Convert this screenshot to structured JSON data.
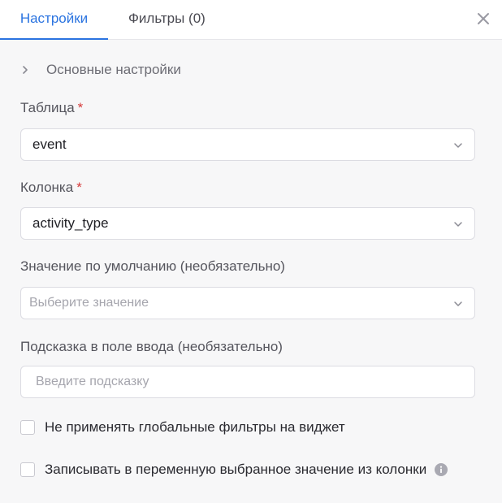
{
  "tabs": {
    "settings": "Настройки",
    "filters": "Фильтры (0)"
  },
  "section": {
    "main_settings": "Основные настройки"
  },
  "fields": {
    "table": {
      "label": "Таблица",
      "required_mark": "*",
      "value": "event"
    },
    "column": {
      "label": "Колонка",
      "required_mark": "*",
      "value": "activity_type"
    },
    "default_value": {
      "label": "Значение по умолчанию (необязательно)",
      "placeholder": "Выберите значение"
    },
    "hint": {
      "label": "Подсказка в поле ввода (необязательно)",
      "placeholder": "Введите подсказку"
    }
  },
  "checkboxes": {
    "ignore_global_filters": {
      "label": "Не применять глобальные фильтры на виджет",
      "checked": false
    },
    "write_to_variable": {
      "label": "Записывать в переменную выбранное значение из колонки",
      "checked": false
    }
  },
  "icons": {
    "close": "close-icon",
    "section_chevron": "chevron-right-icon",
    "select_caret": "chevron-down-icon",
    "info": "info-icon"
  },
  "colors": {
    "accent": "#2b74e0",
    "required": "#d63b3b",
    "background": "#f7f7f8"
  }
}
